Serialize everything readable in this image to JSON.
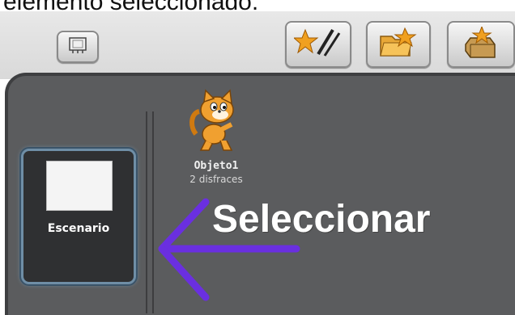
{
  "caption": "elemento seleccionado.",
  "toolbar": {
    "left_button_icon": "presentation-mode-icon",
    "paint_button_icon": "paint-new-sprite-icon",
    "choose_button_icon": "choose-sprite-from-file-icon",
    "surprise_button_icon": "surprise-sprite-icon"
  },
  "stage": {
    "label": "Escenario"
  },
  "sprite": {
    "name": "Objeto1",
    "costumes": "2 disfraces"
  },
  "annotation": {
    "text": "Seleccionar",
    "arrow_color": "#6a2fe0"
  }
}
